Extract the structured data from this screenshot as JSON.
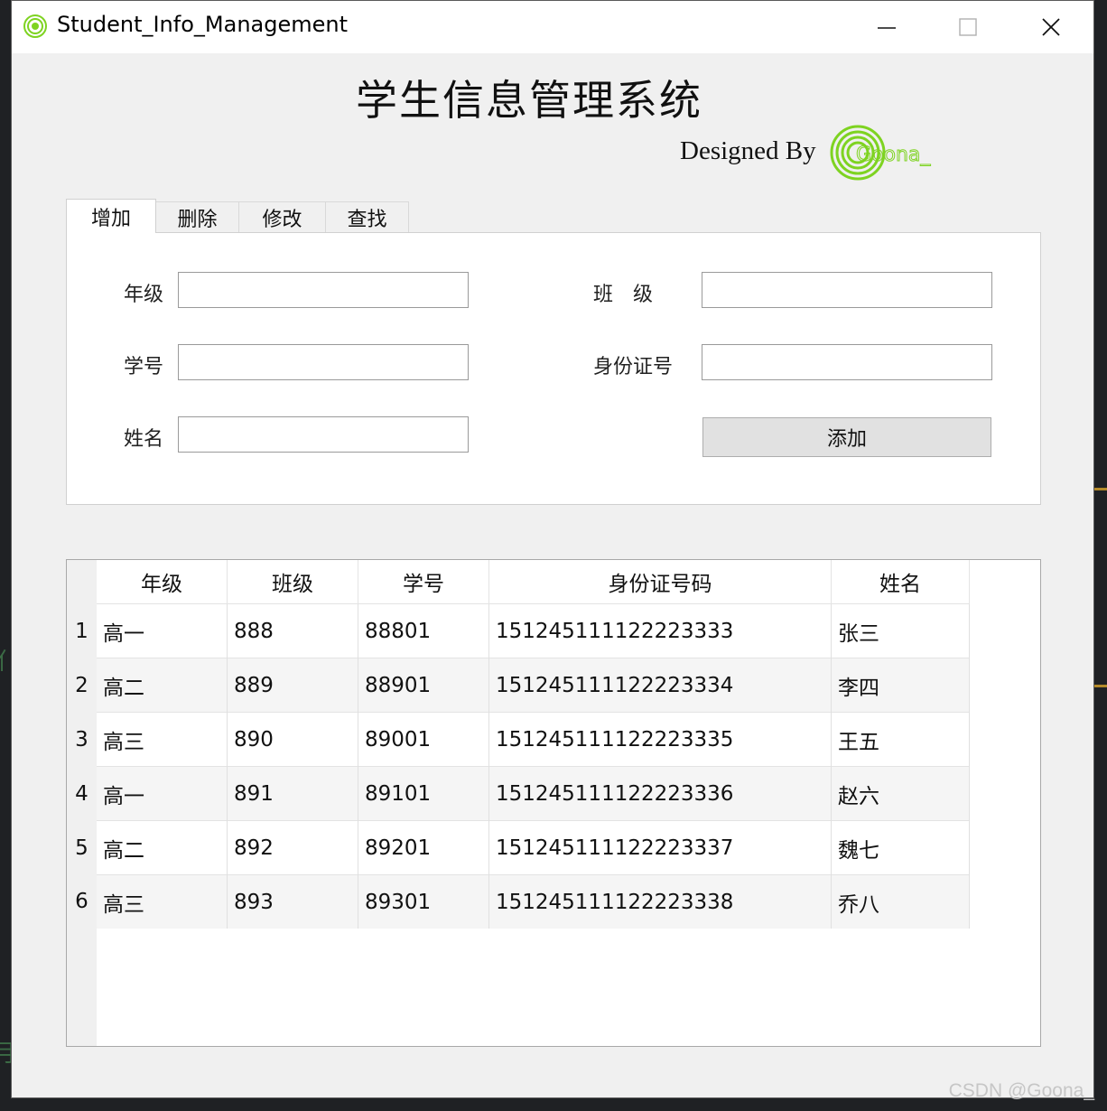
{
  "window": {
    "title": "Student_Info_Management"
  },
  "heading": {
    "title": "学生信息管理系统",
    "designed_by": "Designed By",
    "logo_text": "Goona_"
  },
  "tabs": [
    {
      "label": "增加",
      "active": true
    },
    {
      "label": "删除",
      "active": false
    },
    {
      "label": "修改",
      "active": false
    },
    {
      "label": "查找",
      "active": false
    }
  ],
  "form": {
    "grade_label": "年级",
    "class_label": "班　级",
    "student_id_label": "学号",
    "id_card_label": "身份证号",
    "name_label": "姓名",
    "grade_value": "",
    "class_value": "",
    "student_id_value": "",
    "id_card_value": "",
    "name_value": "",
    "add_button": "添加"
  },
  "table": {
    "columns": [
      "年级",
      "班级",
      "学号",
      "身份证号码",
      "姓名"
    ],
    "rows": [
      {
        "num": "1",
        "cells": [
          "高一",
          "888",
          "88801",
          "151245111122223333",
          "张三"
        ]
      },
      {
        "num": "2",
        "cells": [
          "高二",
          "889",
          "88901",
          "151245111122223334",
          "李四"
        ]
      },
      {
        "num": "3",
        "cells": [
          "高三",
          "890",
          "89001",
          "151245111122223335",
          "王五"
        ]
      },
      {
        "num": "4",
        "cells": [
          "高一",
          "891",
          "89101",
          "151245111122223336",
          "赵六"
        ]
      },
      {
        "num": "5",
        "cells": [
          "高二",
          "892",
          "89201",
          "151245111122223337",
          "魏七"
        ]
      },
      {
        "num": "6",
        "cells": [
          "高三",
          "893",
          "89301",
          "151245111122223338",
          "乔八"
        ]
      }
    ]
  },
  "watermark": "CSDN @Goona_",
  "colors": {
    "logo_green": "#7ed321",
    "accent_line": "#b48a2a"
  }
}
